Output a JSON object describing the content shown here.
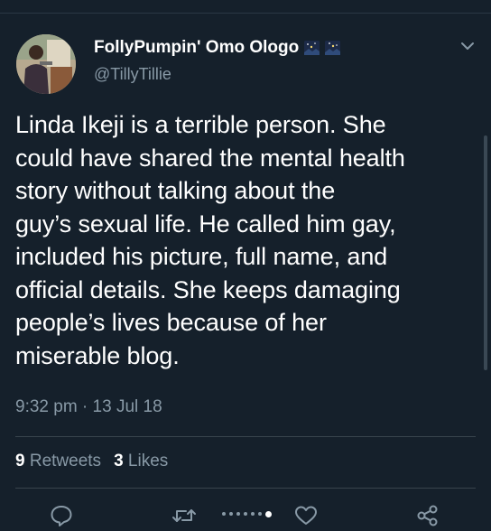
{
  "tweet": {
    "display_name": "FollyPumpin' Omo Ologo",
    "handle": "@TillyTillie",
    "badge_icons": [
      "night-sky-emoji",
      "night-sky-emoji"
    ],
    "text_lines": [
      "Linda Ikeji is a terrible person. She",
      "could have shared the mental health",
      "story without talking about the",
      "guy’s sexual life. He called him gay,",
      "included his picture, full name, and",
      "official details. She keeps damaging",
      "people’s lives because of her",
      "miserable blog."
    ],
    "timestamp": "9:32 pm · 13 Jul 18",
    "retweets_count": "9",
    "retweets_label": "Retweets",
    "likes_count": "3",
    "likes_label": "Likes"
  },
  "actions": [
    "reply-icon",
    "retweet-icon",
    "like-icon",
    "share-icon"
  ],
  "pager": {
    "dot_count": 7,
    "active_index": 6
  },
  "colors": {
    "background": "#15202b",
    "text_primary": "#ffffff",
    "text_secondary": "#8899a6",
    "divider": "#38444d"
  }
}
